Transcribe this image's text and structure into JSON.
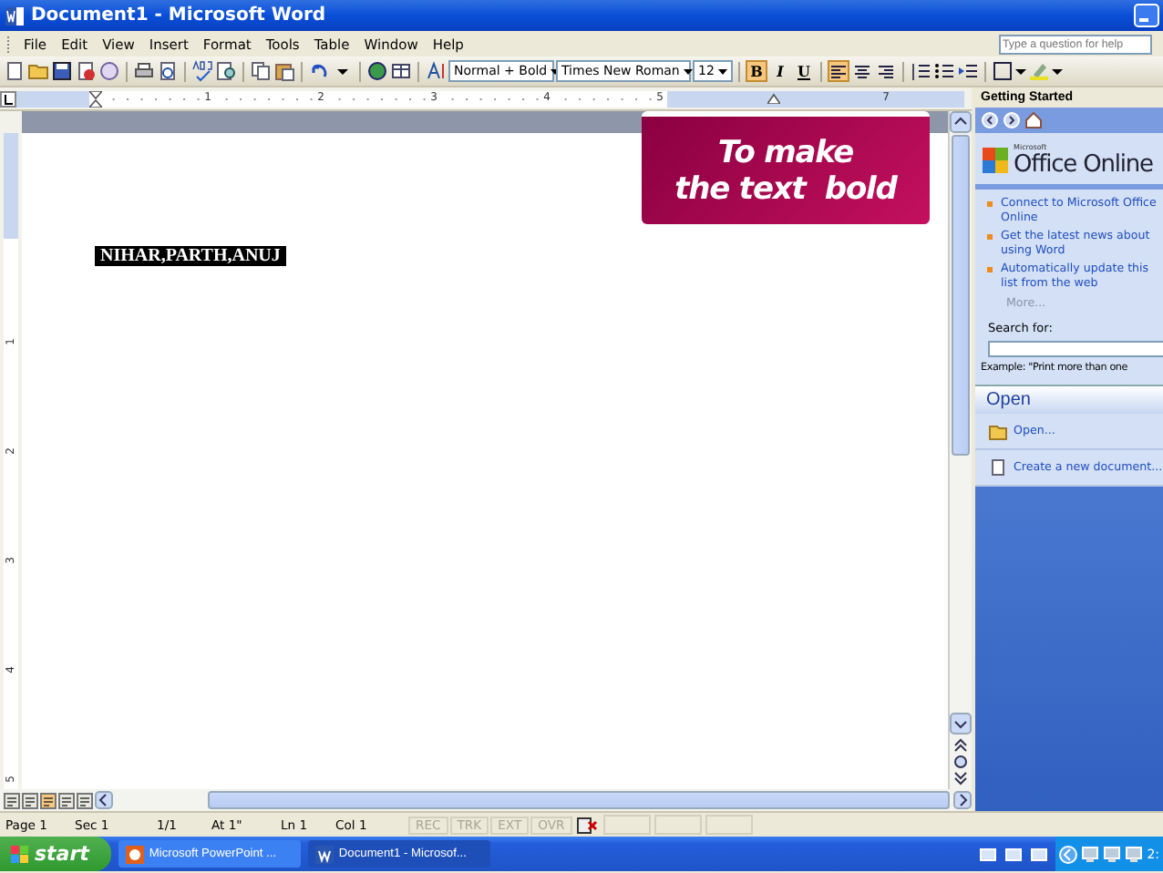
{
  "window": {
    "title": "Document1 - Microsoft Word"
  },
  "menu": [
    "File",
    "Edit",
    "View",
    "Insert",
    "Format",
    "Tools",
    "Table",
    "Window",
    "Help"
  ],
  "help_box": {
    "placeholder": "Type a question for help"
  },
  "toolbar": {
    "style": "Normal + Bold",
    "font": "Times New Roman",
    "size": "12",
    "format_buttons": [
      {
        "kind": "bold",
        "label": "B",
        "selected": true
      },
      {
        "kind": "italic",
        "label": "I",
        "selected": false
      },
      {
        "kind": "underline",
        "label": "U",
        "selected": false
      }
    ],
    "align_buttons": [
      {
        "kind": "left",
        "selected": true
      },
      {
        "kind": "center",
        "selected": false
      },
      {
        "kind": "right",
        "selected": false
      }
    ]
  },
  "ruler": {
    "marks": [
      {
        "kind": "number",
        "label": "1"
      },
      {
        "kind": "number",
        "label": "2"
      },
      {
        "kind": "number",
        "label": "3"
      },
      {
        "kind": "number",
        "label": "4"
      },
      {
        "kind": "number",
        "label": "5"
      },
      {
        "kind": "indent"
      },
      {
        "kind": "number",
        "label": "7"
      }
    ]
  },
  "vertical_ruler": {
    "marks": [
      "1",
      "2",
      "3",
      "4",
      "5"
    ]
  },
  "document": {
    "text": "NIHAR,PARTH,ANUJ",
    "selected": true
  },
  "callout": {
    "lines": [
      "To make",
      "the text  bold"
    ]
  },
  "task_pane": {
    "title": "Getting Started",
    "logo": {
      "brand": "Microsoft",
      "name": "Office Online"
    },
    "links": [
      "Connect to Microsoft Office Online",
      "Get the latest news about using Word",
      "Automatically update this list from the web"
    ],
    "more": "More...",
    "search_label": "Search for:",
    "example": "Example:  \"Print more than one",
    "section": "Open",
    "items": [
      {
        "kind": "open",
        "label": "Open..."
      },
      {
        "kind": "new",
        "label": "Create a new document..."
      }
    ]
  },
  "status_bar": {
    "fields": [
      "Page 1",
      "Sec 1",
      "1/1",
      "At 1\"",
      "Ln 1",
      "Col 1"
    ],
    "modes": [
      {
        "label": "REC",
        "disabled": true
      },
      {
        "label": "TRK",
        "disabled": true
      },
      {
        "label": "EXT",
        "disabled": true
      },
      {
        "label": "OVR",
        "disabled": true
      }
    ]
  },
  "taskbar": {
    "start": "start",
    "clock": "2:",
    "buttons": [
      {
        "kind": "powerpoint",
        "label": "Microsoft PowerPoint ...",
        "selected": false
      },
      {
        "kind": "word",
        "label": "Document1 - Microsof...",
        "selected": true
      }
    ]
  }
}
